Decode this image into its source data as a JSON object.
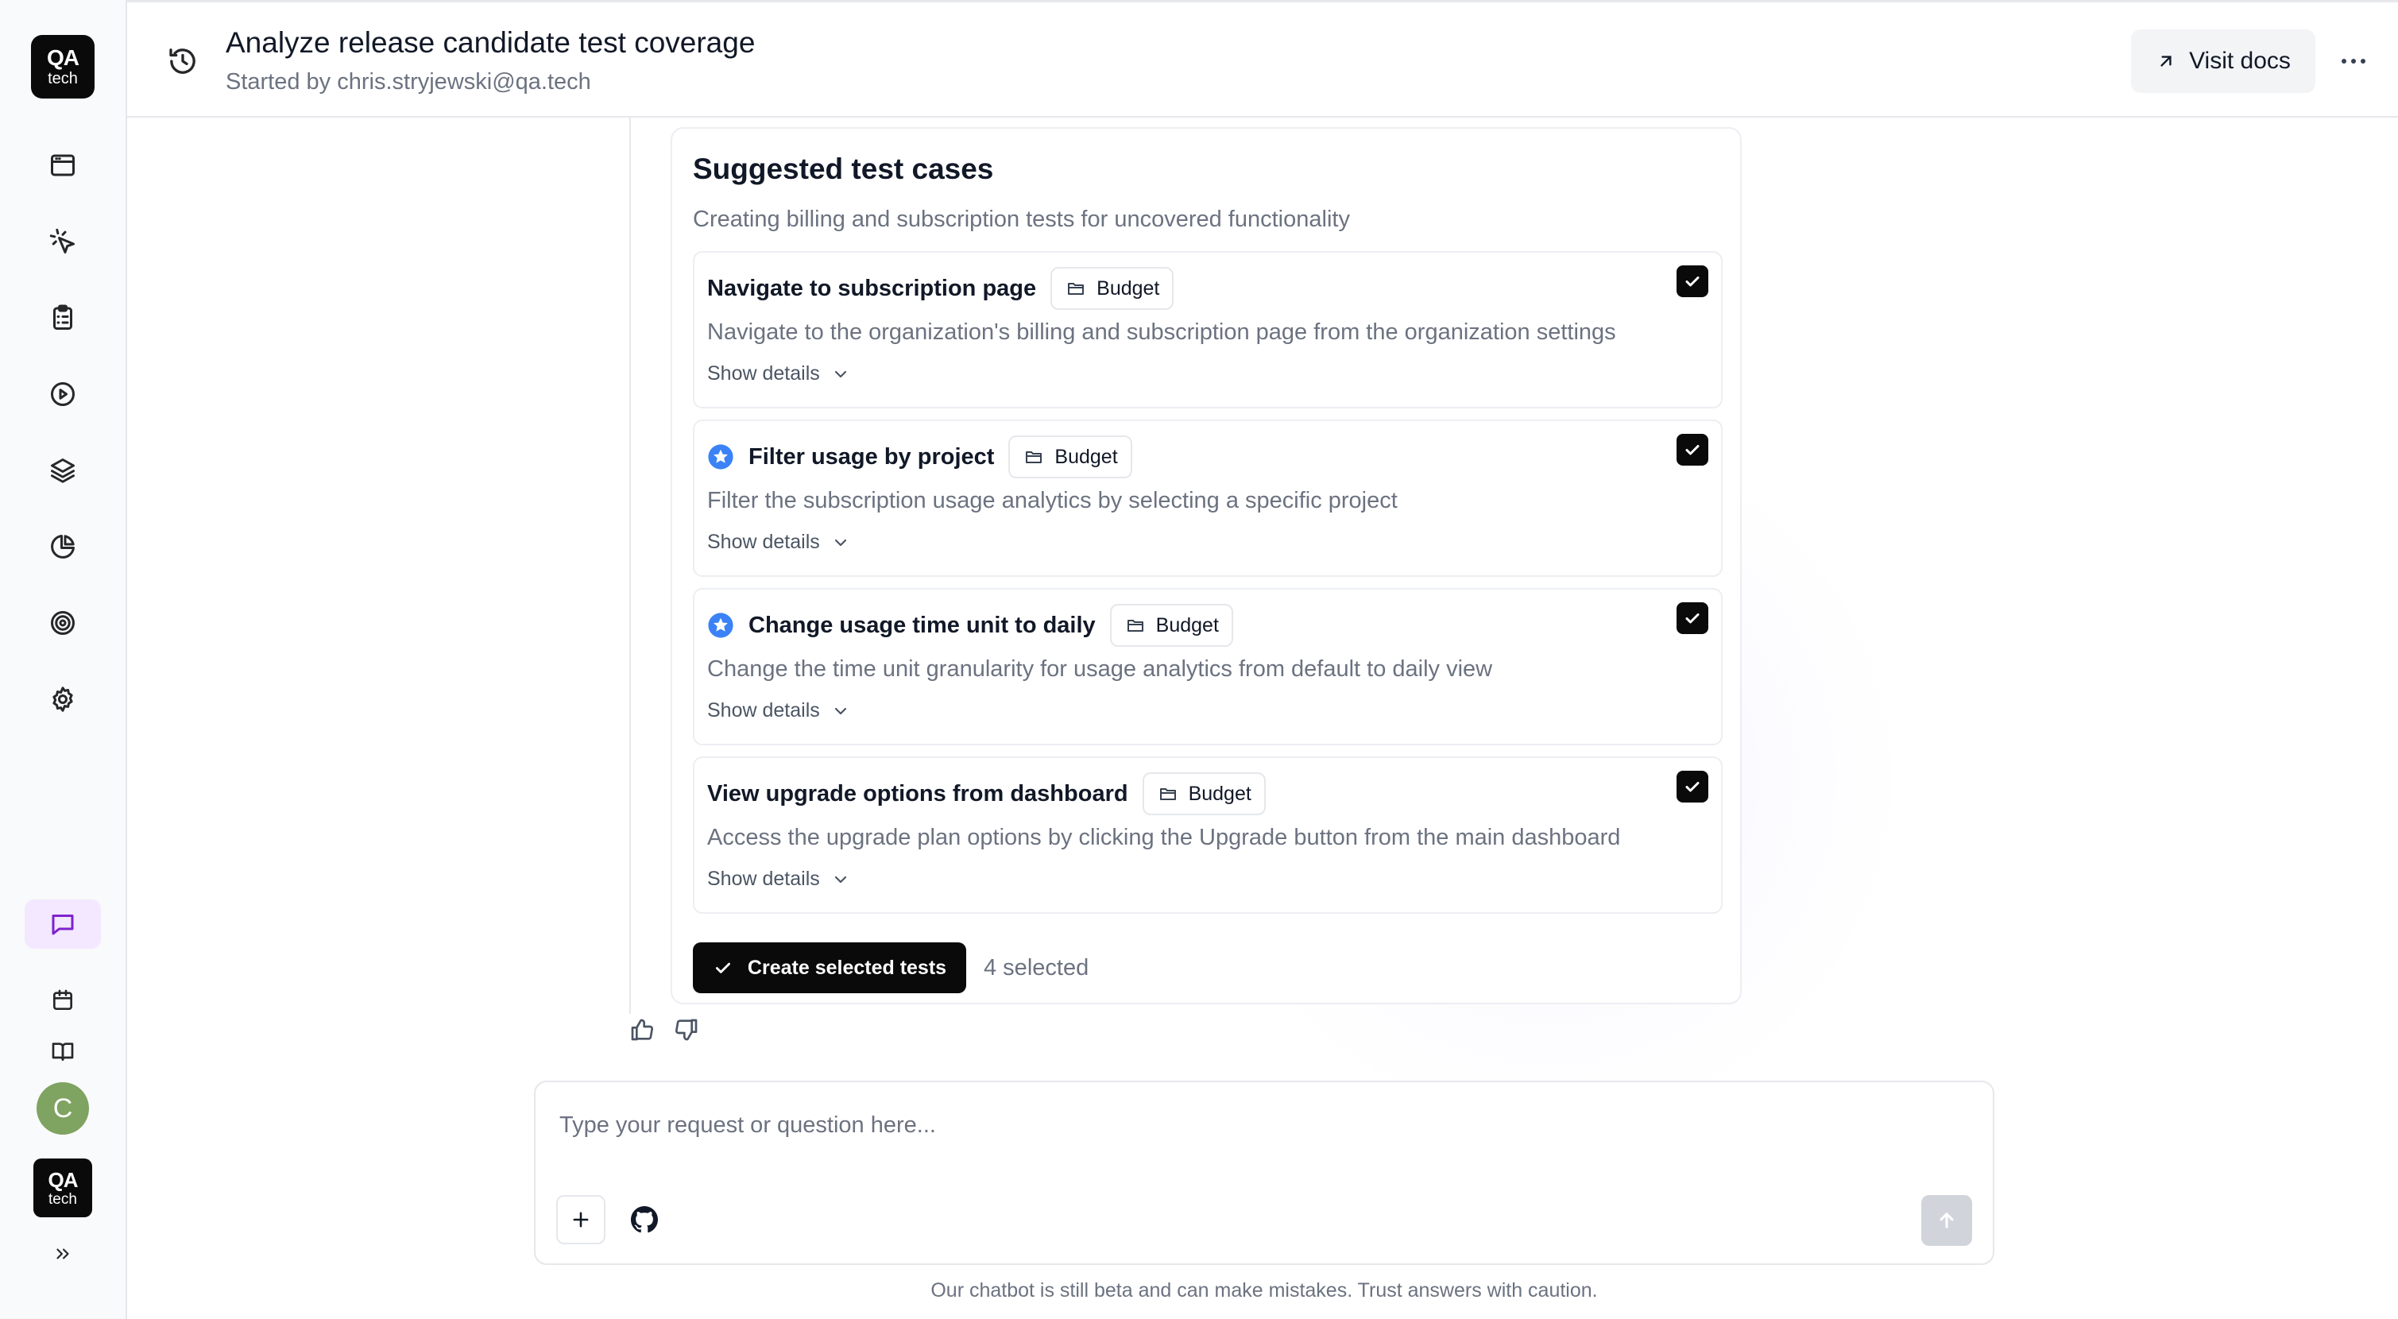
{
  "sidebar": {
    "logo": {
      "line1": "QA",
      "line2": "tech"
    },
    "nav_icons": [
      "browser-window-icon",
      "cursor-click-icon",
      "clipboard-list-icon",
      "play-circle-icon",
      "layers-icon",
      "pie-chart-icon",
      "target-icon",
      "gear-icon"
    ],
    "bottom_icons": [
      "chat-icon",
      "calendar-icon",
      "book-icon"
    ],
    "user_initial": "C",
    "org_logo": {
      "line1": "QA",
      "line2": "tech"
    }
  },
  "header": {
    "title": "Analyze release candidate test coverage",
    "subtitle": "Started by chris.stryjewski@qa.tech",
    "visit_docs_label": "Visit docs"
  },
  "suggestions": {
    "title": "Suggested test cases",
    "subtitle": "Creating billing and subscription tests for uncovered functionality",
    "items": [
      {
        "title": "Navigate to subscription page",
        "tag": "Budget",
        "starred": false,
        "checked": true,
        "description": "Navigate to the organization's billing and subscription page from the organization settings",
        "toggle_label": "Show details"
      },
      {
        "title": "Filter usage by project",
        "tag": "Budget",
        "starred": true,
        "checked": true,
        "description": "Filter the subscription usage analytics by selecting a specific project",
        "toggle_label": "Show details"
      },
      {
        "title": "Change usage time unit to daily",
        "tag": "Budget",
        "starred": true,
        "checked": true,
        "description": "Change the time unit granularity for usage analytics from default to daily view",
        "toggle_label": "Show details"
      },
      {
        "title": "View upgrade options from dashboard",
        "tag": "Budget",
        "starred": false,
        "checked": true,
        "description": "Access the upgrade plan options by clicking the Upgrade button from the main dashboard",
        "toggle_label": "Show details"
      }
    ],
    "create_button_label": "Create selected tests",
    "selected_count": "4 selected"
  },
  "composer": {
    "placeholder": "Type your request or question here...",
    "value": ""
  },
  "disclaimer": "Our chatbot is still beta and can make mistakes. Trust answers with caution.",
  "colors": {
    "accent_purple": "#7e22ce",
    "active_nav_bg": "#f3e8ff",
    "star_blue": "#3b82f6",
    "primary_black": "#0a0a0a",
    "avatar_green": "#7fa360",
    "muted_text": "#6b7280"
  }
}
